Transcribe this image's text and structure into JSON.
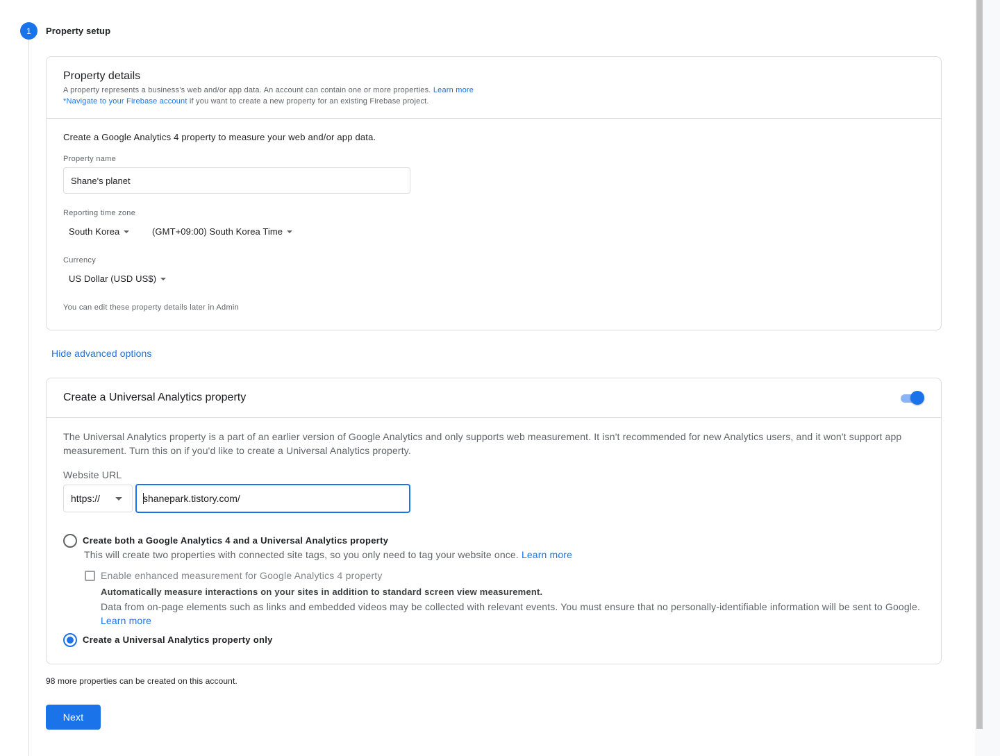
{
  "step": {
    "number": "1",
    "title": "Property setup"
  },
  "property_details": {
    "title": "Property details",
    "desc_line1": "A property represents a business’s web and/or app data. An account can contain one or more properties.",
    "desc_line1_link": "Learn more",
    "desc_line2_link": "*Navigate to your Firebase account",
    "desc_line2": "if you want to create a new property for an existing Firebase project.",
    "intro": "Create a Google Analytics 4 property to measure your web and/or app data.",
    "property_name_label": "Property name",
    "property_name_value": "Shane's planet",
    "timezone_label": "Reporting time zone",
    "country_value": "South Korea",
    "timezone_value": "(GMT+09:00) South Korea Time",
    "currency_label": "Currency",
    "currency_value": "US Dollar (USD US$)",
    "edit_note": "You can edit these property details later in Admin"
  },
  "hide_advanced_label": "Hide advanced options",
  "universal_analytics": {
    "title": "Create a Universal Analytics property",
    "toggle_on": true,
    "description": "The Universal Analytics property is a part of an earlier version of Google Analytics and only supports web measurement. It isn't recommended for new Analytics users, and it won't support app measurement. Turn this on if you'd like to create a Universal Analytics property.",
    "website_url_label": "Website URL",
    "protocol_value": "https://",
    "url_value": "shanepark.tistory.com/",
    "option_both_label": "Create both a Google Analytics 4 and a Universal Analytics property",
    "option_both_desc": "This will create two properties with connected site tags, so you only need to tag your website once.",
    "option_both_link": "Learn more",
    "enhanced_label": "Enable enhanced measurement for Google Analytics 4 property",
    "enhanced_title": "Automatically measure interactions on your sites in addition to standard screen view measurement.",
    "enhanced_desc": "Data from on-page elements such as links and embedded videos may be collected with relevant events. You must ensure that no personally-identifiable information will be sent to Google.",
    "enhanced_link": "Learn more",
    "option_ua_only_label": "Create a Universal Analytics property only",
    "selected_option": "ua_only"
  },
  "footer": {
    "more_properties": "98 more properties can be created on this account.",
    "next_label": "Next"
  },
  "colors": {
    "accent": "#1a73e8",
    "border": "#dadce0",
    "secondary_text": "#5f6368"
  }
}
